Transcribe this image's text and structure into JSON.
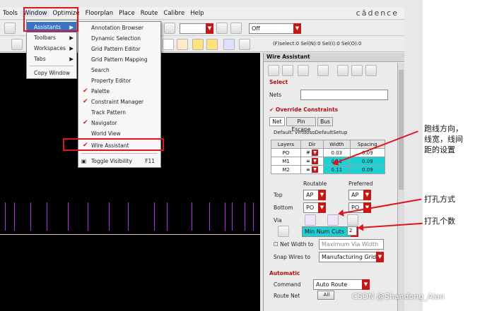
{
  "menubar": {
    "items": [
      "Tools",
      "Window",
      "Optimize",
      "Floorplan",
      "Place",
      "Route",
      "Calibre",
      "Help"
    ],
    "logo": "cādence"
  },
  "window_menu": {
    "items": [
      {
        "label": "Assistants",
        "has_submenu": true,
        "highlighted": true
      },
      {
        "label": "Toolbars",
        "has_submenu": true
      },
      {
        "label": "Workspaces",
        "has_submenu": true
      },
      {
        "label": "Tabs",
        "has_submenu": true
      },
      {
        "label": "Copy Window",
        "has_submenu": false
      }
    ]
  },
  "assistants_menu": {
    "items": [
      {
        "label": "Annotation Browser",
        "checked": false
      },
      {
        "label": "Dynamic Selection",
        "checked": false
      },
      {
        "label": "Grid Pattern Editor",
        "checked": false
      },
      {
        "label": "Grid Pattern Mapping",
        "checked": false
      },
      {
        "label": "Search",
        "checked": false
      },
      {
        "label": "Property Editor",
        "checked": false
      },
      {
        "label": "Palette",
        "checked": true
      },
      {
        "label": "Constraint Manager",
        "checked": true
      },
      {
        "label": "Track Pattern",
        "checked": false
      },
      {
        "label": "Navigator",
        "checked": true
      },
      {
        "label": "World View",
        "checked": false
      },
      {
        "label": "Wire Assistant",
        "checked": true
      }
    ],
    "toggle": {
      "label": "Toggle Visibility",
      "shortcut": "F11"
    }
  },
  "toolbar": {
    "layer_dropdown": "Off",
    "status_text": "(F)select:0   Sel(N):0   Sel(I):0   Sel(O):0"
  },
  "wire_assistant": {
    "title": "Wire Assistant",
    "select_section": "Select",
    "nets_label": "Nets",
    "nets_value": "",
    "override_label": "Override Constraints",
    "override_checked": true,
    "tabs": [
      "Net",
      "Pin Escape",
      "Bus"
    ],
    "default_text": "Default: virtuosoDefaultSetup",
    "table": {
      "headers": [
        "Layers",
        "Dir",
        "Width",
        "Spacing"
      ],
      "rows": [
        {
          "layer": "PO",
          "width": "0.03",
          "spacing": "0.09",
          "highlight": false
        },
        {
          "layer": "M1",
          "width": "0.11",
          "spacing": "0.09",
          "highlight": true
        },
        {
          "layer": "M2",
          "width": "0.11",
          "spacing": "0.09",
          "highlight": true
        }
      ]
    },
    "routable_label": "Routable",
    "preferred_label": "Preferred",
    "top_label": "Top",
    "top_routable": "AP",
    "top_preferred": "AP",
    "bottom_label": "Bottom",
    "bottom_routable": "PO",
    "bottom_preferred": "PO",
    "via_label": "Via",
    "via_mode": "Min Num Cuts",
    "via_count": "2",
    "net_width_label": "Net Width to",
    "net_width_value": "Maximum Via Width",
    "snap_label": "Snap Wires to",
    "snap_value": "Manufacturing Grid",
    "automatic_label": "Automatic",
    "command_label": "Command",
    "command_value": "Auto Route",
    "route_net_label": "Route Net",
    "route_net_button": "All"
  },
  "annotations": {
    "wire_settings": "跑线方向，\n线宽，线间\n距的设置",
    "via_method": "打孔方式",
    "via_count": "打孔个数"
  },
  "watermark": "CSDN @Shandong_Alan",
  "colors": {
    "accent_red": "#e0141c",
    "cyan_cell": "#1ecfd4",
    "trace_purple": "#b030e0"
  }
}
